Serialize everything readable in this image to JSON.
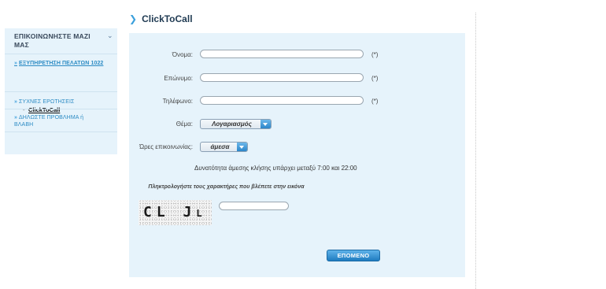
{
  "sidebar": {
    "title": "ΕΠΙΚΟΙΝΩΝΗΣΤΕ ΜΑΖΙ ΜΑΣ",
    "items": [
      {
        "label": "ΕΞΥΠΗΡΕΤΗΣΗ ΠΕΛΑΤΩΝ 1022"
      },
      {
        "label": "ΣΥΧΝΕΣ ΕΡΩΤΗΣΕΙΣ"
      },
      {
        "label": "ΔΗΛΩΣΤΕ ΠΡΟΒΛΗΜΑ ή ΒΛΑΒΗ"
      }
    ],
    "sub_item": "ClickToCall"
  },
  "page": {
    "title": "ClickToCall"
  },
  "form": {
    "first_name": {
      "label": "Όνομα:",
      "value": "",
      "required_mark": "(*)"
    },
    "last_name": {
      "label": "Επώνυμο:",
      "value": "",
      "required_mark": "(*)"
    },
    "phone": {
      "label": "Τηλέφωνο:",
      "value": "",
      "required_mark": "(*)"
    },
    "subject": {
      "label": "Θέμα:",
      "selected": "Λογαριασμός"
    },
    "contact_hours": {
      "label": "Ώρες επικοινωνίας:",
      "selected": "άμεσα"
    },
    "info_text": "Δυνατότητα άμεσης κλήσης υπάρχει μεταξύ 7:00 και 22:00",
    "captcha_prompt": "Πληκτρολογήστε τους χαρακτήρες που βλέπετε στην εικόνα",
    "captcha_text": "CL J",
    "captcha_text_small": "L",
    "captcha_value": "",
    "next_button": "ΕΠΟΜΕΝΟ"
  },
  "colors": {
    "accent": "#2c8bc4",
    "panel_bg": "#e6f3fb",
    "button": "#1f7cc0"
  }
}
